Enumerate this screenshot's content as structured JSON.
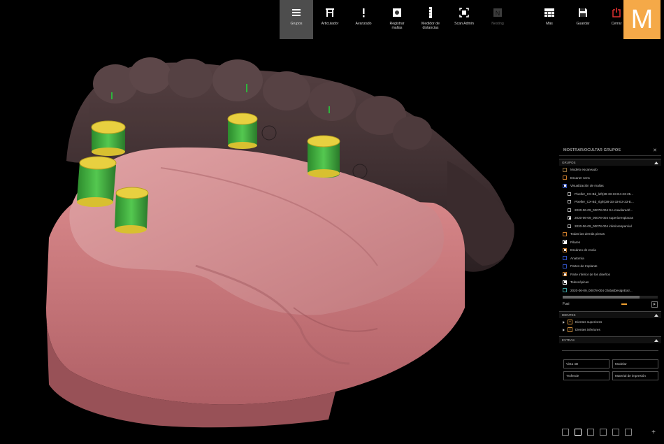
{
  "toolbar": {
    "items": [
      {
        "label": "Grupos",
        "icon": "menu-icon",
        "active": true
      },
      {
        "label": "Articulador",
        "icon": "articulator-icon"
      },
      {
        "label": "Avanzado",
        "icon": "exclamation-icon"
      },
      {
        "label": "Registrar\nmallas",
        "icon": "register-meshes-icon"
      },
      {
        "label": "Medidor de\ndistancias",
        "icon": "distance-meter-icon"
      },
      {
        "label": "Scan Admin",
        "icon": "scan-admin-icon"
      },
      {
        "label": "Nesting",
        "icon": "nesting-icon",
        "disabled": true
      }
    ],
    "right_items": [
      {
        "label": "Más",
        "icon": "more-icon"
      },
      {
        "label": "Guardar",
        "icon": "save-icon"
      },
      {
        "label": "Cerrar",
        "icon": "close-power-icon"
      }
    ],
    "logo_letter": "M",
    "accent": "#f5a948"
  },
  "panel": {
    "title": "MOSTRAR/OCULTAR GRUPOS",
    "groups_section": "GRUPOS",
    "groups": [
      {
        "label": "Modelo escaneado",
        "color": "#8a6a3a",
        "type": "box",
        "checked": false,
        "level": 0
      },
      {
        "label": "Escaner sens",
        "color": "#c87a2a",
        "type": "box",
        "checked": false,
        "level": 0
      },
      {
        "label": "Visualización de mallas",
        "color": "#3050c0",
        "type": "box",
        "checked": true,
        "level": 0
      },
      {
        "label": "Pixeller_CX-Bd_left(28-33-33-E4-23-25...",
        "type": "sq",
        "checked": false,
        "level": 1
      },
      {
        "label": "Pixeller_CX-Bd_right(28-33-33-E3-23-E...",
        "type": "sq",
        "checked": false,
        "level": 1
      },
      {
        "label": "2020-06-09_00078-004 SA-maxilaredrl...",
        "type": "sq",
        "checked": false,
        "level": 1
      },
      {
        "label": "2020-06-09_00078-004 superioresplacas",
        "type": "sq",
        "checked": true,
        "level": 1
      },
      {
        "label": "2020-06-09_00078-004 inferioresparcial",
        "type": "sq",
        "checked": false,
        "level": 1
      },
      {
        "label": "Todas las demás piezas",
        "color": "#c87a2a",
        "type": "box",
        "checked": false,
        "level": 0
      },
      {
        "label": "Pilares",
        "color": "#ffffff",
        "type": "box",
        "checked": true,
        "level": 0
      },
      {
        "label": "Escáneo de encía",
        "color": "#c87a2a",
        "type": "box",
        "checked": true,
        "level": 0
      },
      {
        "label": "Anatomía",
        "color": "#3050c0",
        "type": "box",
        "checked": false,
        "level": 0
      },
      {
        "label": "Partes de Implante",
        "color": "#3050c0",
        "type": "box",
        "checked": false,
        "level": 0
      },
      {
        "label": "Parte inferior de los diseños",
        "color": "#c87a2a",
        "type": "box",
        "checked": true,
        "level": 0
      },
      {
        "label": "Telescópicas",
        "color": "#ffffff",
        "type": "box",
        "checked": true,
        "level": 0
      },
      {
        "label": "2020-06-09_00078-004 GlobalDesignExtr...",
        "color": "#3a9a9a",
        "type": "box",
        "checked": false,
        "level": 0
      }
    ],
    "opacity_label": "Fusi",
    "teeth_section": "DIENTES",
    "teeth": [
      {
        "label": "Dientes superiores"
      },
      {
        "label": "Dientes inferiores"
      }
    ],
    "extra_section": "EXTRAS",
    "actions": [
      "Vista 4D",
      "Modelar",
      "Trufende",
      "Material de impresión"
    ]
  }
}
